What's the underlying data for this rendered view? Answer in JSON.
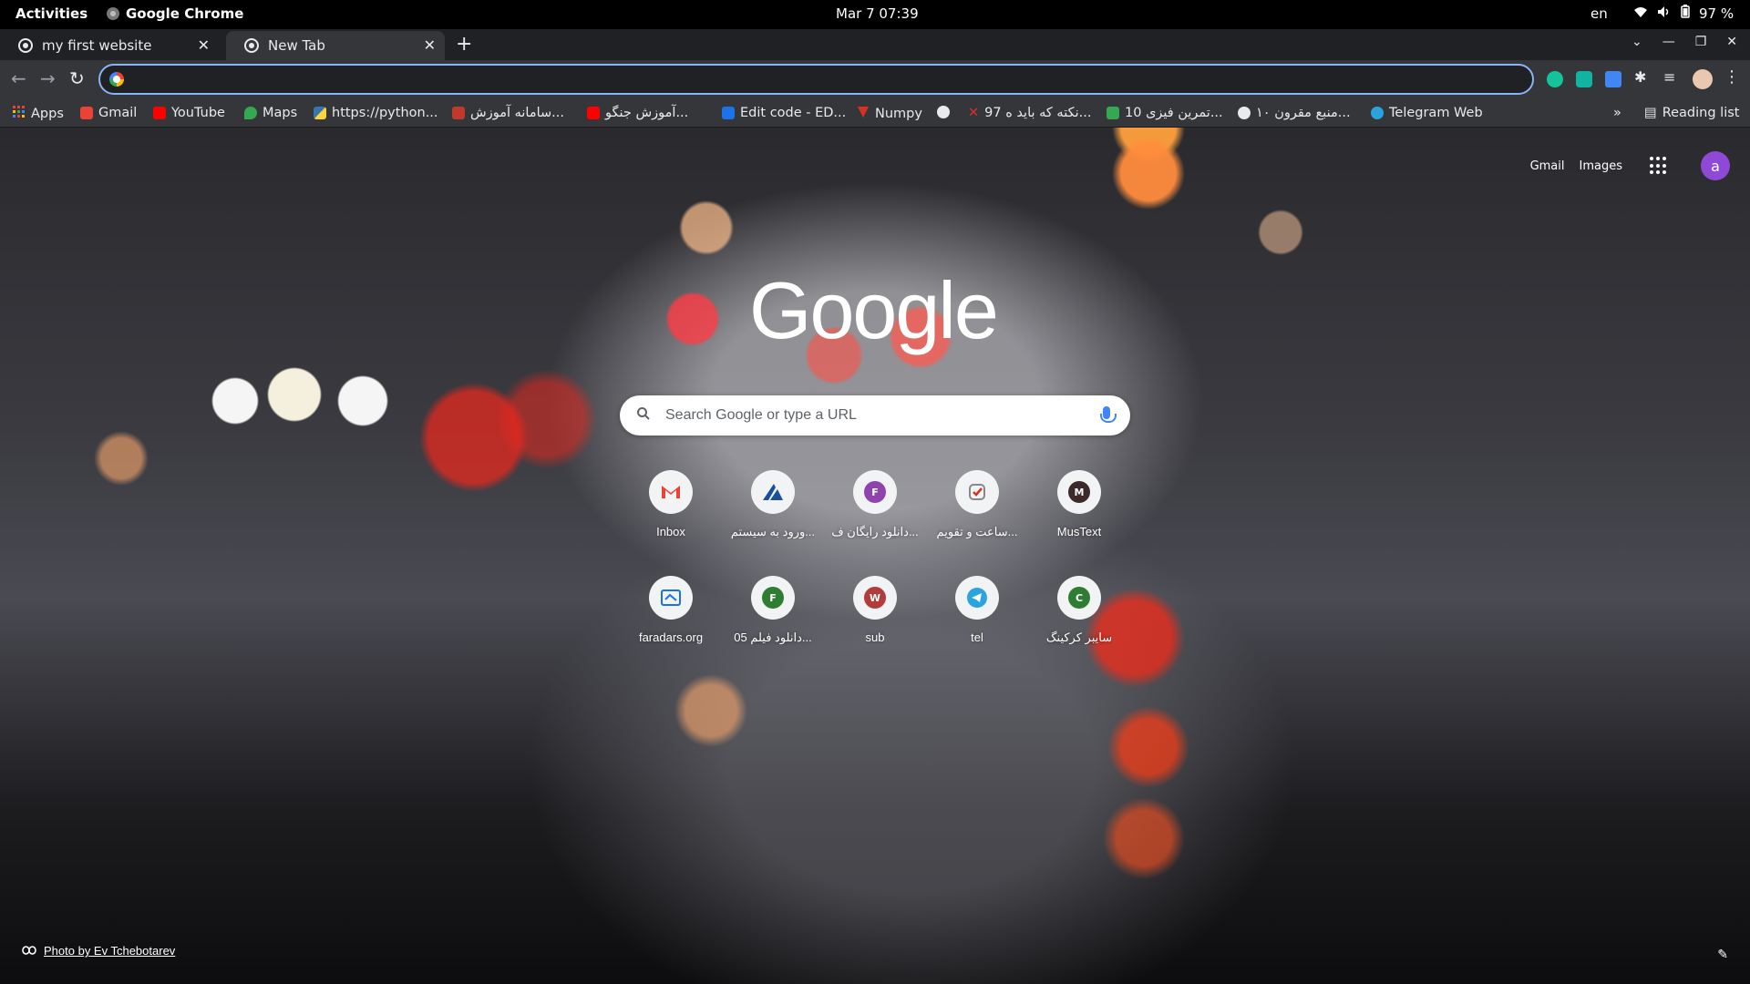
{
  "system": {
    "activities": "Activities",
    "app_name": "Google Chrome",
    "clock": "Mar 7  07:39",
    "lang": "en",
    "battery": "97 %"
  },
  "tabs": [
    {
      "title": "my first website",
      "active": false
    },
    {
      "title": "New Tab",
      "active": true
    }
  ],
  "omnibox": {
    "value": "",
    "placeholder": ""
  },
  "bookmarks": [
    {
      "label": "Apps",
      "icon": "apps-grid-icon",
      "color": "#ea4335"
    },
    {
      "label": "Gmail",
      "icon": "gmail-icon",
      "color": "#ea4335"
    },
    {
      "label": "YouTube",
      "icon": "youtube-icon",
      "color": "#ff0000"
    },
    {
      "label": "Maps",
      "icon": "maps-pin-icon",
      "color": "#34a853"
    },
    {
      "label": "https://python...",
      "icon": "python-icon",
      "color": "#3776ab"
    },
    {
      "label": "سامانه آموزش...",
      "icon": "site-icon",
      "color": "#c0392b"
    },
    {
      "label": "آموزش جنگو...",
      "icon": "youtube-icon",
      "color": "#ff0000"
    },
    {
      "label": "Edit code - ED...",
      "icon": "edx-icon",
      "color": "#1a73e8"
    },
    {
      "label": "Numpy",
      "icon": "numpy-icon",
      "color": "#d93025"
    },
    {
      "label": "",
      "icon": "globe-icon",
      "color": "#e8eaed"
    },
    {
      "label": "97 نکته که باید ه...",
      "icon": "x-icon",
      "color": "#d93025"
    },
    {
      "label": "10 تمرین فیزی...",
      "icon": "site-icon",
      "color": "#34a853"
    },
    {
      "label": "۱۰ منبع مقرون...",
      "icon": "globe-icon",
      "color": "#e8eaed"
    },
    {
      "label": "Telegram Web",
      "icon": "telegram-icon",
      "color": "#2aa3df"
    }
  ],
  "reading_list": "Reading list",
  "ntp": {
    "links": {
      "gmail": "Gmail",
      "images": "Images"
    },
    "avatar_letter": "a",
    "logo": "Google",
    "search_placeholder": "Search Google or type a URL",
    "tiles": [
      {
        "label": "Inbox",
        "letter": "M",
        "color": "#ea4335"
      },
      {
        "label": "ورود به سیستم...",
        "letter": "",
        "color": "#1a73e8"
      },
      {
        "label": "دانلود رایگان ف...",
        "letter": "F",
        "color": "#8e44ad"
      },
      {
        "label": "ساعت و تقویم...",
        "letter": "",
        "color": "#d93025"
      },
      {
        "label": "MusText",
        "letter": "M",
        "color": "#3c2a2a"
      },
      {
        "label": "faradars.org",
        "letter": "",
        "color": "#1a73e8"
      },
      {
        "label": "دانلود فیلم 05...",
        "letter": "F",
        "color": "#2e7d32"
      },
      {
        "label": "sub",
        "letter": "W",
        "color": "#b23b3b"
      },
      {
        "label": "tel",
        "letter": "",
        "color": "#2aa3df"
      },
      {
        "label": "سایبر کرکینگ",
        "letter": "C",
        "color": "#2e7d32"
      }
    ],
    "credit": "Photo by Ev Tchebotarev"
  }
}
